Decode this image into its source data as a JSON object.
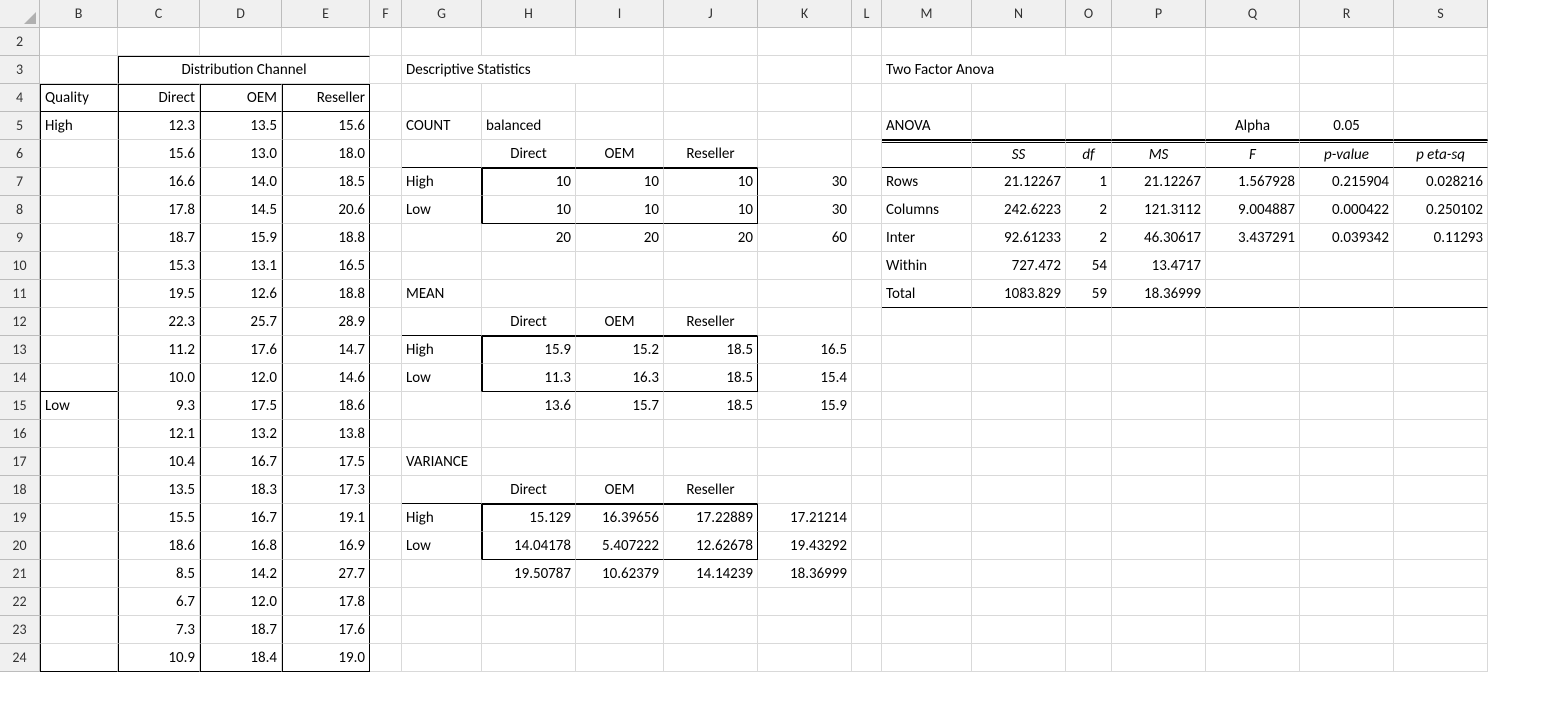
{
  "cols": [
    "B",
    "C",
    "D",
    "E",
    "F",
    "G",
    "H",
    "I",
    "J",
    "K",
    "L",
    "M",
    "N",
    "O",
    "P",
    "Q",
    "R",
    "S"
  ],
  "rows": [
    "2",
    "3",
    "4",
    "5",
    "6",
    "7",
    "8",
    "9",
    "10",
    "11",
    "12",
    "13",
    "14",
    "15",
    "16",
    "17",
    "18",
    "19",
    "20",
    "21",
    "22",
    "23",
    "24"
  ],
  "main_title": "Distribution Channel",
  "quality_label": "Quality",
  "main_headers": {
    "c": "Direct",
    "d": "OEM",
    "e": "Reseller"
  },
  "quality_levels": {
    "high": "High",
    "low": "Low"
  },
  "raw_data": {
    "high": [
      {
        "c": "12.3",
        "d": "13.5",
        "e": "15.6"
      },
      {
        "c": "15.6",
        "d": "13.0",
        "e": "18.0"
      },
      {
        "c": "16.6",
        "d": "14.0",
        "e": "18.5"
      },
      {
        "c": "17.8",
        "d": "14.5",
        "e": "20.6"
      },
      {
        "c": "18.7",
        "d": "15.9",
        "e": "18.8"
      },
      {
        "c": "15.3",
        "d": "13.1",
        "e": "16.5"
      },
      {
        "c": "19.5",
        "d": "12.6",
        "e": "18.8"
      },
      {
        "c": "22.3",
        "d": "25.7",
        "e": "28.9"
      },
      {
        "c": "11.2",
        "d": "17.6",
        "e": "14.7"
      },
      {
        "c": "10.0",
        "d": "12.0",
        "e": "14.6"
      }
    ],
    "low": [
      {
        "c": "9.3",
        "d": "17.5",
        "e": "18.6"
      },
      {
        "c": "12.1",
        "d": "13.2",
        "e": "13.8"
      },
      {
        "c": "10.4",
        "d": "16.7",
        "e": "17.5"
      },
      {
        "c": "13.5",
        "d": "18.3",
        "e": "17.3"
      },
      {
        "c": "15.5",
        "d": "16.7",
        "e": "19.1"
      },
      {
        "c": "18.6",
        "d": "16.8",
        "e": "16.9"
      },
      {
        "c": "8.5",
        "d": "14.2",
        "e": "27.7"
      },
      {
        "c": "6.7",
        "d": "12.0",
        "e": "17.8"
      },
      {
        "c": "7.3",
        "d": "18.7",
        "e": "17.6"
      },
      {
        "c": "10.9",
        "d": "18.4",
        "e": "19.0"
      }
    ]
  },
  "desc_title": "Descriptive Statistics",
  "count_label": "COUNT",
  "balanced_label": "balanced",
  "mean_label": "MEAN",
  "variance_label": "VARIANCE",
  "channel_headers": {
    "h": "Direct",
    "i": "OEM",
    "j": "Reseller"
  },
  "row_labels": {
    "high": "High",
    "low": "Low"
  },
  "count": {
    "high": {
      "h": "10",
      "i": "10",
      "j": "10",
      "k": "30"
    },
    "low": {
      "h": "10",
      "i": "10",
      "j": "10",
      "k": "30"
    },
    "tot": {
      "h": "20",
      "i": "20",
      "j": "20",
      "k": "60"
    }
  },
  "mean": {
    "high": {
      "h": "15.9",
      "i": "15.2",
      "j": "18.5",
      "k": "16.5"
    },
    "low": {
      "h": "11.3",
      "i": "16.3",
      "j": "18.5",
      "k": "15.4"
    },
    "tot": {
      "h": "13.6",
      "i": "15.7",
      "j": "18.5",
      "k": "15.9"
    }
  },
  "variance": {
    "high": {
      "h": "15.129",
      "i": "16.39656",
      "j": "17.22889",
      "k": "17.21214"
    },
    "low": {
      "h": "14.04178",
      "i": "5.407222",
      "j": "12.62678",
      "k": "19.43292"
    },
    "tot": {
      "h": "19.50787",
      "i": "10.62379",
      "j": "14.14239",
      "k": "18.36999"
    }
  },
  "anova_title": "Two Factor Anova",
  "anova_label": "ANOVA",
  "alpha_label": "Alpha",
  "alpha_value": "0.05",
  "anova_headers": {
    "n": "SS",
    "o": "df",
    "p": "MS",
    "q": "F",
    "r": "p-value",
    "s": "p eta-sq"
  },
  "anova_rows": {
    "rows": {
      "label": "Rows",
      "n": "21.12267",
      "o": "1",
      "p": "21.12267",
      "q": "1.567928",
      "r": "0.215904",
      "s": "0.028216"
    },
    "columns": {
      "label": "Columns",
      "n": "242.6223",
      "o": "2",
      "p": "121.3112",
      "q": "9.004887",
      "r": "0.000422",
      "s": "0.250102"
    },
    "inter": {
      "label": "Inter",
      "n": "92.61233",
      "o": "2",
      "p": "46.30617",
      "q": "3.437291",
      "r": "0.039342",
      "s": "0.11293"
    },
    "within": {
      "label": "Within",
      "n": "727.472",
      "o": "54",
      "p": "13.4717",
      "q": "",
      "r": "",
      "s": ""
    },
    "total": {
      "label": "Total",
      "n": "1083.829",
      "o": "59",
      "p": "18.36999",
      "q": "",
      "r": "",
      "s": ""
    }
  }
}
